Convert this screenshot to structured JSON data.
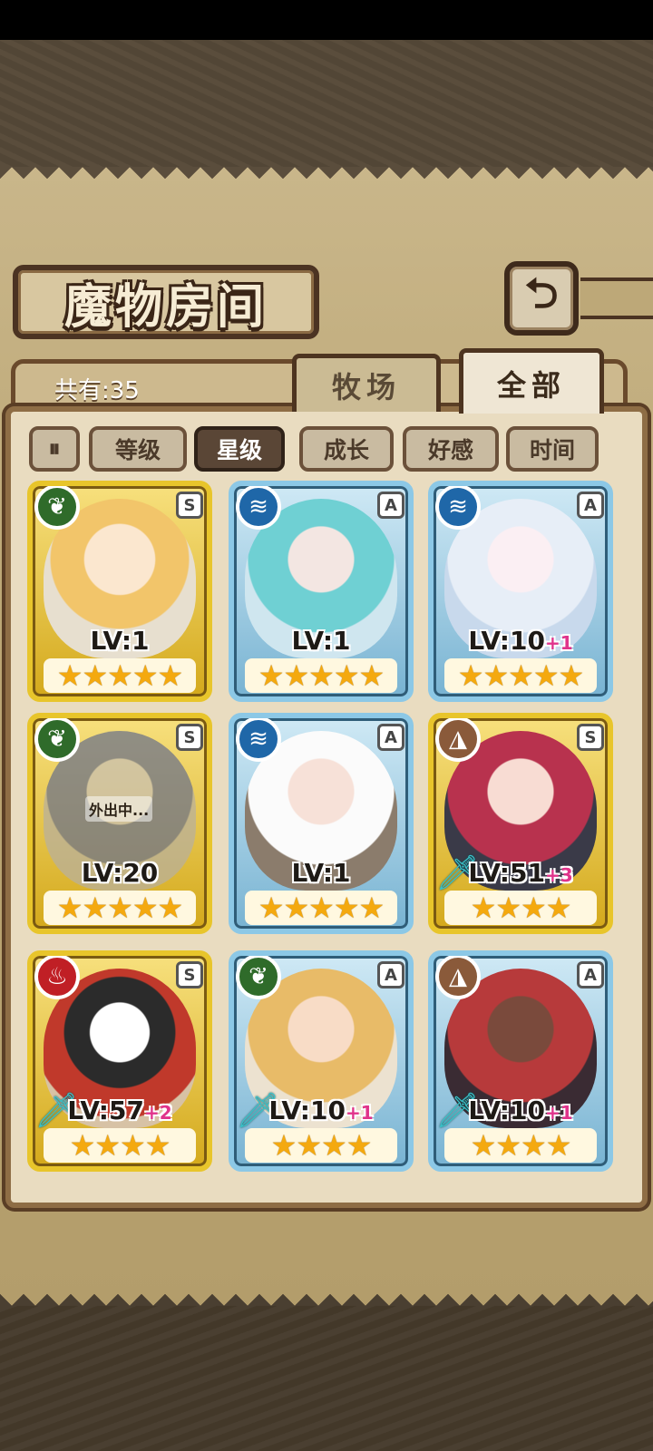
{
  "header": {
    "title": "魔物房间",
    "back_icon": "back-arrow-icon",
    "count_label": "共有:35"
  },
  "tabs": [
    {
      "label": "牧场",
      "active": false
    },
    {
      "label": "全部",
      "active": true
    }
  ],
  "sort": {
    "toggle_icon": "sort-toggle-icon",
    "buttons": [
      {
        "label": "等级",
        "active": false
      },
      {
        "label": "星级",
        "active": true
      },
      {
        "label": "成长",
        "active": false
      },
      {
        "label": "好感",
        "active": false
      },
      {
        "label": "时间",
        "active": false
      }
    ]
  },
  "monsters": [
    {
      "element": "grass",
      "element_icon": "leaf-icon",
      "rank": "S",
      "level": "LV:1",
      "plus": "",
      "stars": "★★★★★",
      "frame": "gold",
      "status": "",
      "weapon": false
    },
    {
      "element": "water",
      "element_icon": "water-icon",
      "rank": "A",
      "level": "LV:1",
      "plus": "",
      "stars": "★★★★★",
      "frame": "blue",
      "status": "",
      "weapon": false
    },
    {
      "element": "water",
      "element_icon": "water-icon",
      "rank": "A",
      "level": "LV:10",
      "plus": "+1",
      "stars": "★★★★★",
      "frame": "blue",
      "status": "",
      "weapon": false
    },
    {
      "element": "grass",
      "element_icon": "leaf-icon",
      "rank": "S",
      "level": "LV:20",
      "plus": "",
      "stars": "★★★★★",
      "frame": "gold",
      "status": "外出中...",
      "weapon": false
    },
    {
      "element": "water",
      "element_icon": "water-icon",
      "rank": "A",
      "level": "LV:1",
      "plus": "",
      "stars": "★★★★★",
      "frame": "blue",
      "status": "",
      "weapon": false
    },
    {
      "element": "earth",
      "element_icon": "mountain-icon",
      "rank": "S",
      "level": "LV:51",
      "plus": "+3",
      "stars": "★★★★",
      "frame": "gold",
      "status": "",
      "weapon": true
    },
    {
      "element": "fire",
      "element_icon": "flame-icon",
      "rank": "S",
      "level": "LV:57",
      "plus": "+2",
      "stars": "★★★★",
      "frame": "gold",
      "status": "",
      "weapon": true
    },
    {
      "element": "grass",
      "element_icon": "leaf-icon",
      "rank": "A",
      "level": "LV:10",
      "plus": "+1",
      "stars": "★★★★",
      "frame": "blue",
      "status": "",
      "weapon": true
    },
    {
      "element": "earth",
      "element_icon": "mountain-icon",
      "rank": "A",
      "level": "LV:10",
      "plus": "+1",
      "stars": "★★★★",
      "frame": "blue",
      "status": "",
      "weapon": true
    }
  ],
  "colors": {
    "gold_frame": "#e8c52b",
    "blue_frame": "#8cc8e6",
    "plus_text": "#e0338b",
    "star": "#f4a90f"
  }
}
